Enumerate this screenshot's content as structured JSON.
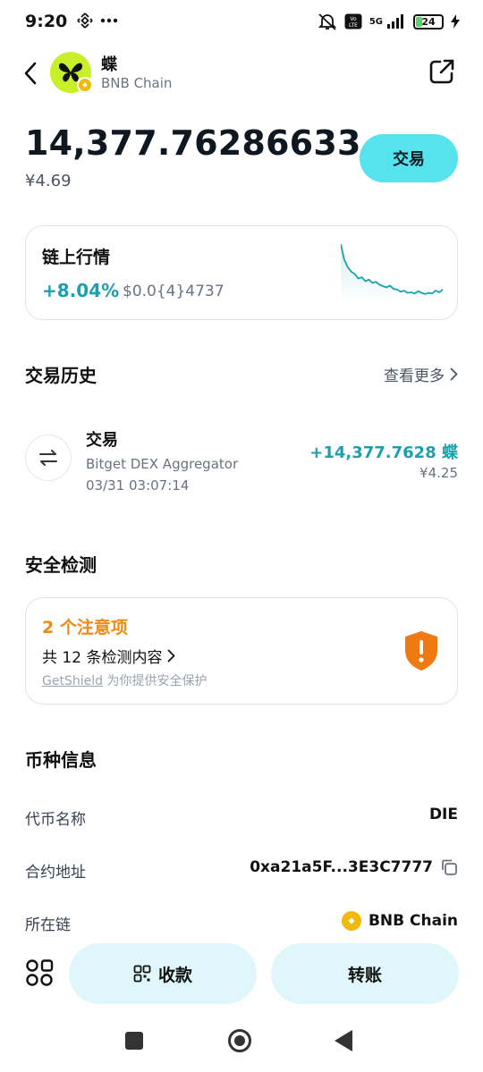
{
  "status_bar": {
    "time": "9:20",
    "network": "5G",
    "battery": "24",
    "icons": [
      "binance-icon",
      "more-dots-icon",
      "mute-icon",
      "volte-icon",
      "signal-icon",
      "battery-icon",
      "charging-icon"
    ]
  },
  "header": {
    "token_name": "蝶",
    "chain_name": "BNB Chain"
  },
  "balance": {
    "amount": "14,377.76286633",
    "fiat": "¥4.69"
  },
  "trade_button": {
    "label": "交易"
  },
  "market": {
    "title": "链上行情",
    "change": "+8.04%",
    "price": "$0.0{4}4737",
    "sparkline": [
      1.0,
      0.72,
      0.58,
      0.5,
      0.46,
      0.38,
      0.4,
      0.33,
      0.36,
      0.3,
      0.32,
      0.27,
      0.24,
      0.22,
      0.25,
      0.19,
      0.18,
      0.14,
      0.16,
      0.12,
      0.13,
      0.11,
      0.15,
      0.12,
      0.1,
      0.12,
      0.11,
      0.16,
      0.13,
      0.18
    ],
    "color": "#1ba1ad"
  },
  "history": {
    "title": "交易历史",
    "more_label": "查看更多",
    "items": [
      {
        "type": "交易",
        "source": "Bitget DEX Aggregator",
        "date": "03/31 03:07:14",
        "amount": "+14,377.7628 蝶",
        "fiat": "¥4.25"
      }
    ]
  },
  "security": {
    "title": "安全检测",
    "warning": "2 个注意项",
    "checks": "共 12 条检测内容",
    "provider_name": "GetShield",
    "provider_text": "为你提供安全保护",
    "warning_color": "#ef8a12"
  },
  "token_info": {
    "title": "币种信息",
    "rows": [
      {
        "label": "代币名称",
        "value": "DIE"
      },
      {
        "label": "合约地址",
        "value": "0xa21a5F...3E3C7777"
      },
      {
        "label": "所在链",
        "value": "BNB Chain"
      }
    ]
  },
  "bottom_actions": {
    "receive": "收款",
    "transfer": "转账"
  },
  "colors": {
    "accent": "#57e3ee",
    "positive": "#1ba1ad",
    "bnb": "#f0b90b",
    "token_logo": "#c8ef2a"
  }
}
